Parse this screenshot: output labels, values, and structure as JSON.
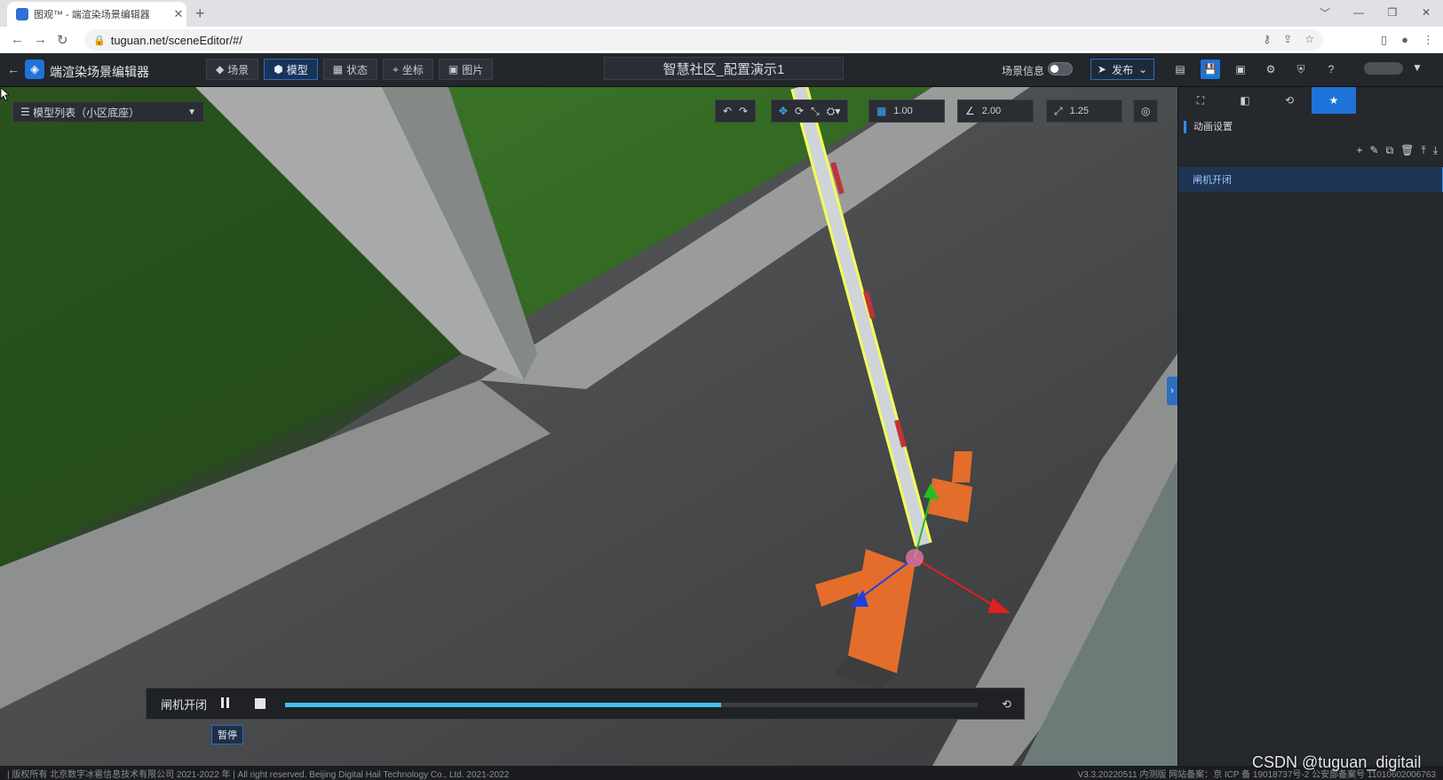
{
  "browser": {
    "tab_title": "图观™ - 端渲染场景编辑器",
    "new_tab": "+",
    "url": "tuguan.net/sceneEditor/#/",
    "window_buttons": [
      "﹀",
      "—",
      "❐",
      "✕"
    ]
  },
  "header": {
    "app_title": "端渲染场景编辑器",
    "tabs": [
      {
        "label": "场景",
        "icon": "layers-icon"
      },
      {
        "label": "模型",
        "icon": "cube-icon",
        "active": true
      },
      {
        "label": "状态",
        "icon": "grid-icon"
      },
      {
        "label": "坐标",
        "icon": "pin-icon"
      },
      {
        "label": "图片",
        "icon": "image-icon"
      }
    ],
    "scene_title": "智慧社区_配置演示1",
    "scene_info_label": "场景信息",
    "publish_label": "发布"
  },
  "viewport": {
    "model_list_label": "模型列表（小区底座）",
    "grid_value": "1.00",
    "angle_value": "2.00",
    "scale_value": "1.25"
  },
  "player": {
    "animation_name": "闸机开闭",
    "progress": 0.63,
    "tooltip": "暂停"
  },
  "right_panel": {
    "section_title": "动画设置",
    "items": [
      "闸机开闭"
    ]
  },
  "footer": {
    "copyright": "| 版权所有 北京数字冰雹信息技术有限公司 2021-2022 年 | All right reserved. Beijing Digital Hail Technology Co., Ltd. 2021-2022",
    "version": "V3.3.20220511 内测版 网站备案：京 ICP 备 19018737号-2 公安部备案号 11010602006763"
  },
  "watermark": "CSDN @tuguan_digitail",
  "colors": {
    "accent": "#1e73d8",
    "progress": "#3fc3ef"
  }
}
